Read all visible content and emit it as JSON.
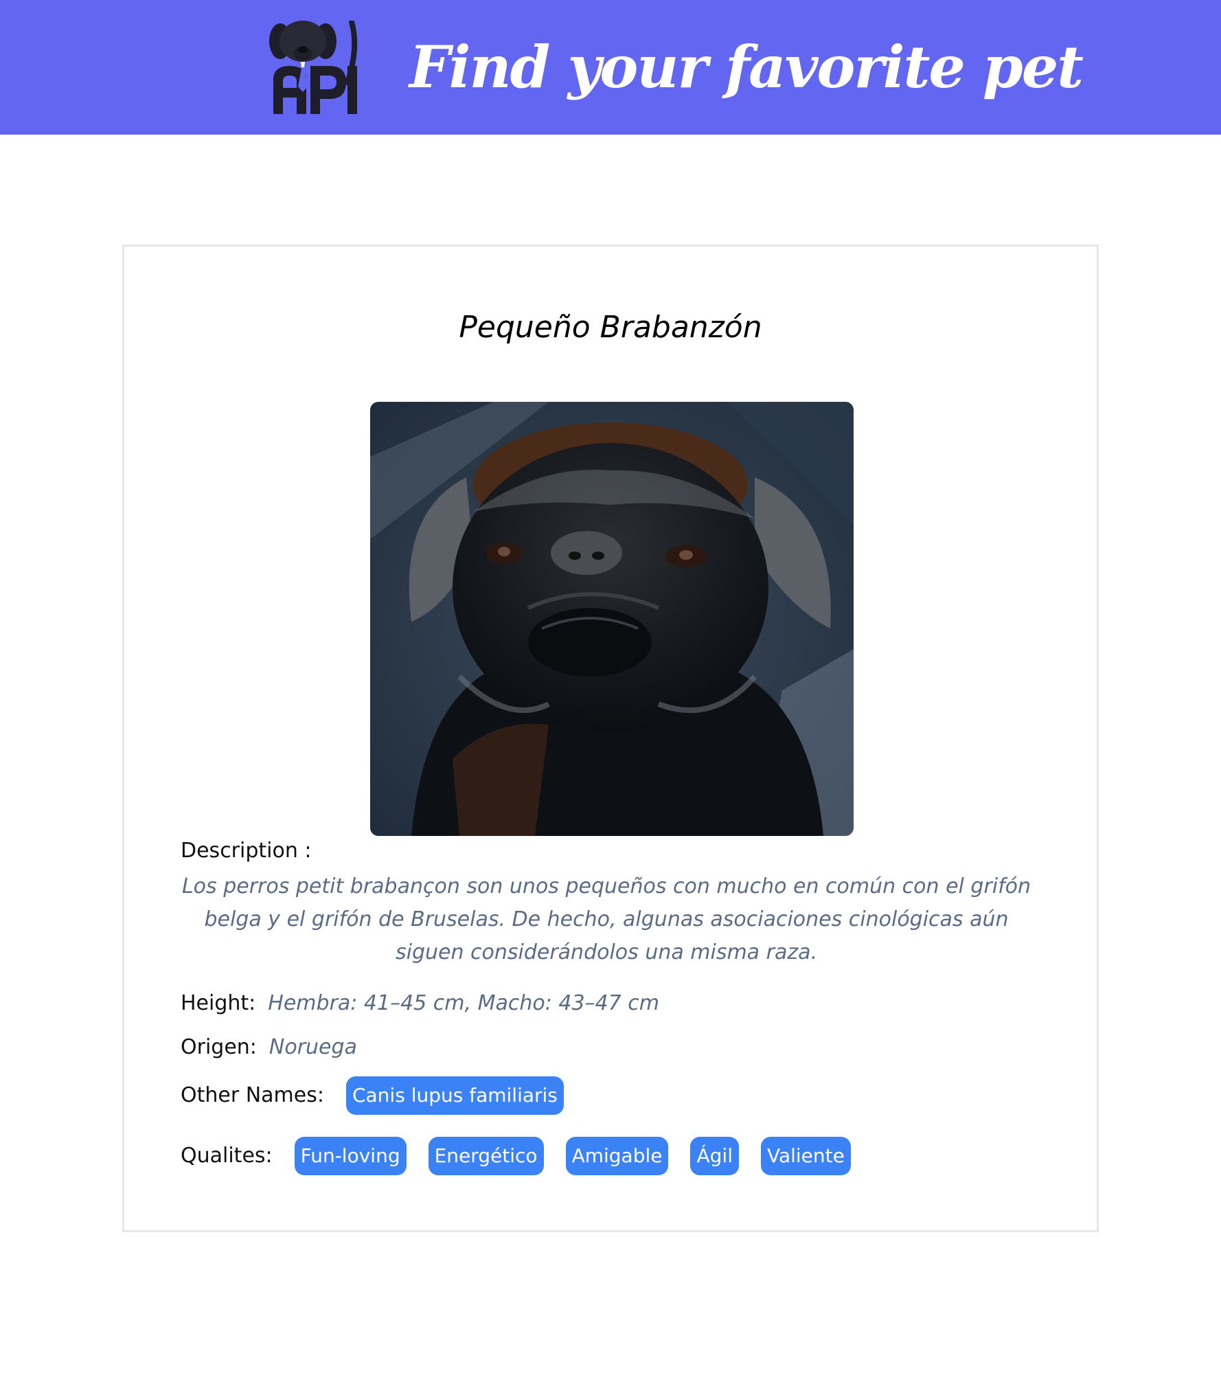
{
  "colors": {
    "brand": "#6366f1",
    "chip": "#3b82f6",
    "value_text": "#5a6b85"
  },
  "header": {
    "logo_icon": "dog-api-logo-icon",
    "logo_text": "API",
    "title": "Find your favorite pet"
  },
  "pet": {
    "name": "Pequeño Brabanzón",
    "photo_icon": "dog-photo",
    "description_label": "Description :",
    "description": "Los perros petit brabançon son unos pequeños con mucho en común con el grifón belga y el grifón de Bruselas. De hecho, algunas asociaciones cinológicas aún siguen considerándolos una misma raza.",
    "height_label": "Height:",
    "height": "Hembra: 41–45 cm, Macho: 43–47 cm",
    "origin_label": "Origen:",
    "origin": "Noruega",
    "other_names_label": "Other Names:",
    "other_names": [
      "Canis lupus familiaris"
    ],
    "qualities_label": "Qualites:",
    "qualities": [
      "Fun-loving",
      "Energético",
      "Amigable",
      "Ágil",
      "Valiente"
    ]
  }
}
